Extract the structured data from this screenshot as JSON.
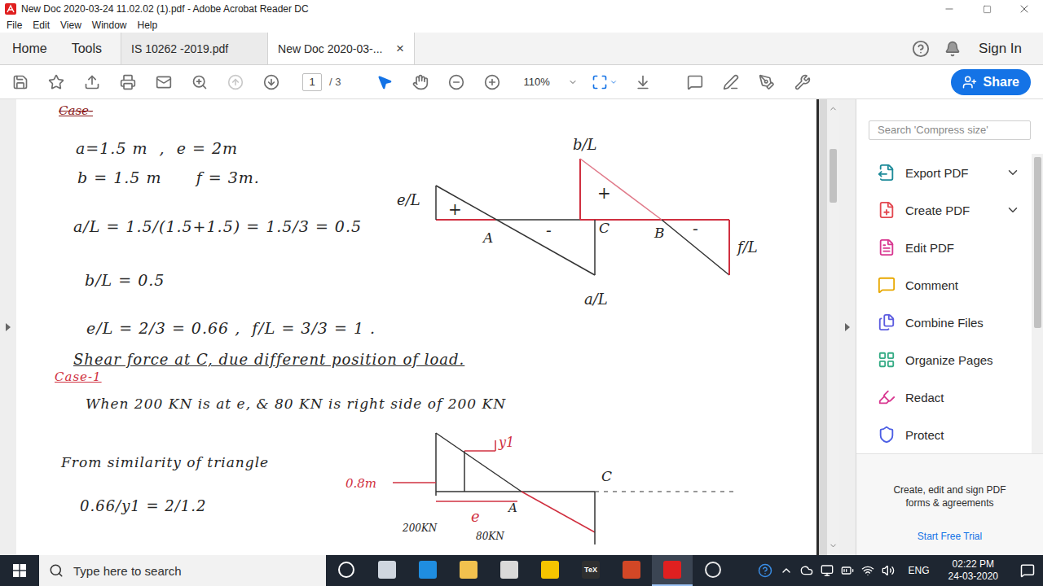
{
  "window": {
    "title": "New Doc 2020-03-24 11.02.02 (1).pdf - Adobe Acrobat Reader DC"
  },
  "menu": [
    "File",
    "Edit",
    "View",
    "Window",
    "Help"
  ],
  "tabs": [
    {
      "label": "Home",
      "selected": false,
      "kind": "nav"
    },
    {
      "label": "Tools",
      "selected": false,
      "kind": "nav"
    },
    {
      "label": "IS 10262 -2019.pdf",
      "selected": false,
      "kind": "doc"
    },
    {
      "label": "New Doc 2020-03-...",
      "selected": true,
      "kind": "doc"
    }
  ],
  "tab_close": "×",
  "account": {
    "sign_in": "Sign In"
  },
  "toolbar": {
    "page": "1",
    "page_count": "/ 3",
    "zoom": "110%",
    "share": "Share",
    "prev_page_disabled": true,
    "select_tool_active": true
  },
  "document": {
    "heading": "Case-",
    "given": [
      "a=1.5 m  ,  e = 2m",
      "b = 1.5 m      f = 3m."
    ],
    "ratios": [
      "a/L = 1.5/(1.5+1.5) = 1.5/3 = 0.5",
      "b/L = 0.5",
      "e/L = 2/3 = 0.66 ,  f/L = 3/3 = 1 ."
    ],
    "influence_line": {
      "e_l": "e/L",
      "b_l": "b/L",
      "a_l": "a/L",
      "f_l": "f/L",
      "a": "A",
      "b": "B",
      "c": "C",
      "plus": "+",
      "minus": "-"
    },
    "section_title": "Shear force at C, due different position of load.",
    "case": "Case-1",
    "statement": "When 200 KN is at e, & 80 KN is right side of 200 KN",
    "similarity": "From similarity of triangle",
    "equation": "0.66/y1 = 2/1.2",
    "load_diagram": {
      "y1": "y1",
      "distance": "0.8m",
      "c": "C",
      "e": "e",
      "a": "A",
      "load1": "200KN",
      "load2": "80KN"
    }
  },
  "tools_panel": {
    "search_placeholder": "Search 'Compress size'",
    "items": [
      {
        "label": "Export PDF",
        "color": "#1d8a99",
        "expandable": true
      },
      {
        "label": "Create PDF",
        "color": "#e34850",
        "expandable": true
      },
      {
        "label": "Edit PDF",
        "color": "#d83790",
        "expandable": false
      },
      {
        "label": "Comment",
        "color": "#e8a800",
        "expandable": false
      },
      {
        "label": "Combine Files",
        "color": "#5c5ce0",
        "expandable": false
      },
      {
        "label": "Organize Pages",
        "color": "#33ab84",
        "expandable": false
      },
      {
        "label": "Redact",
        "color": "#d83790",
        "expandable": false
      },
      {
        "label": "Protect",
        "color": "#4b5ee4",
        "expandable": false
      }
    ],
    "promo": "Create, edit and sign PDF forms & agreements",
    "trial": "Start Free Trial"
  },
  "taskbar": {
    "search_placeholder": "Type here to search",
    "apps": [
      {
        "kind": "ring",
        "label": "",
        "color": "#ffffff",
        "active": false
      },
      {
        "kind": "tile",
        "label": "",
        "color": "#cfd6df",
        "active": false
      },
      {
        "kind": "tile",
        "label": "",
        "color": "#1f8de0",
        "active": false
      },
      {
        "kind": "tile",
        "label": "",
        "color": "#f2c14e",
        "active": false
      },
      {
        "kind": "tile",
        "label": "",
        "color": "#d9d9d9",
        "active": false
      },
      {
        "kind": "tile",
        "label": "",
        "color": "#f5c400",
        "active": false
      },
      {
        "kind": "tile",
        "label": "TeX",
        "color": "#2f2f2f",
        "active": false
      },
      {
        "kind": "tile",
        "label": "",
        "color": "#d24726",
        "active": false
      },
      {
        "kind": "tile",
        "label": "",
        "color": "#e02020",
        "active": true
      },
      {
        "kind": "ring",
        "label": "",
        "color": "#e8e8e8",
        "active": false
      }
    ],
    "language": "ENG",
    "time": "02:22 PM",
    "date": "24-03-2020"
  }
}
